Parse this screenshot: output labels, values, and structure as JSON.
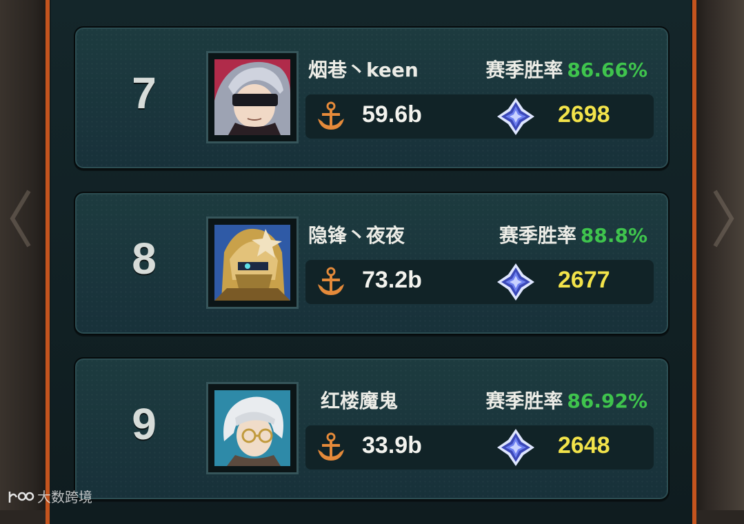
{
  "leaderboard": {
    "winrate_label": "赛季胜率",
    "entries": [
      {
        "rank": "7",
        "name": "烟巷丶keen",
        "winrate": "86.66%",
        "power": "59.6b",
        "score": "2698",
        "avatar": "masked-silver-hair-hero-portrait"
      },
      {
        "rank": "8",
        "name": "隐锋丶夜夜",
        "winrate": "88.8%",
        "power": "73.2b",
        "score": "2677",
        "avatar": "golden-armored-knight-portrait"
      },
      {
        "rank": "9",
        "name": "红楼魔鬼",
        "winrate": "86.92%",
        "power": "33.9b",
        "score": "2648",
        "avatar": "white-haired-scholar-with-glasses-portrait"
      }
    ]
  },
  "icons": {
    "power": "anchor-icon",
    "score": "crystal-star-icon"
  },
  "colors": {
    "winrate": "#3fc44d",
    "score": "#f2e34a",
    "frame_accent": "#c4541e"
  },
  "watermark": {
    "text": "大数跨境"
  }
}
